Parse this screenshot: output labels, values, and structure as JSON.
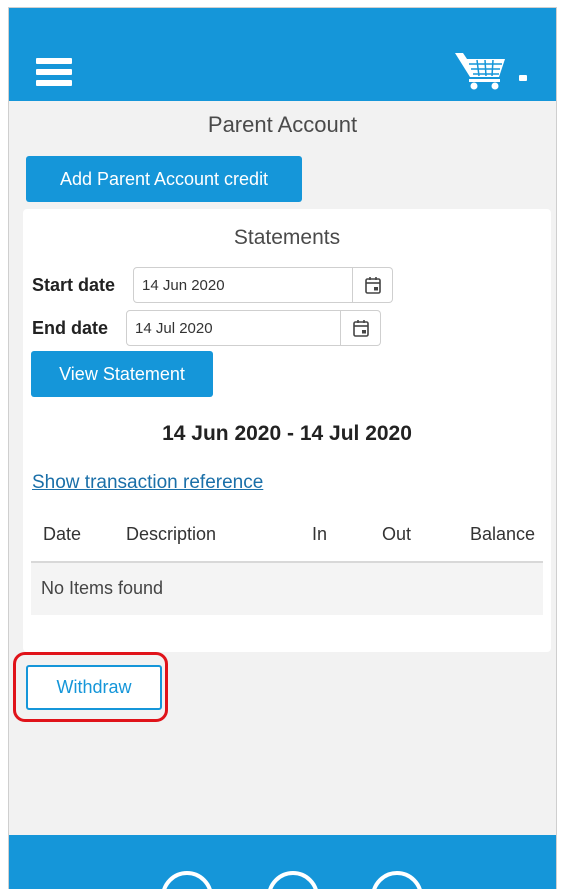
{
  "header": {
    "menu_icon": "hamburger-menu-icon",
    "cart_icon": "shopping-cart-icon",
    "caret_icon": "caret-down-icon"
  },
  "page": {
    "title": "Parent Account",
    "add_credit_label": "Add Parent Account credit"
  },
  "statements": {
    "title": "Statements",
    "start_label": "Start date",
    "start_value": "14 Jun 2020",
    "end_label": "End date",
    "end_value": "14 Jul 2020",
    "calendar_icon": "calendar-icon",
    "view_label": "View Statement",
    "range_text": "14 Jun 2020 - 14 Jul 2020",
    "show_ref_label": "Show transaction reference",
    "columns": [
      "Date",
      "Description",
      "In",
      "Out",
      "Balance"
    ],
    "empty_text": "No Items found"
  },
  "actions": {
    "withdraw_label": "Withdraw"
  },
  "footer": {
    "social_icons": [
      "twitter-icon",
      "facebook-icon",
      "email-icon"
    ]
  },
  "colors": {
    "primary": "#1596d9",
    "highlight": "#e0131a",
    "background": "#f2f2f2"
  }
}
